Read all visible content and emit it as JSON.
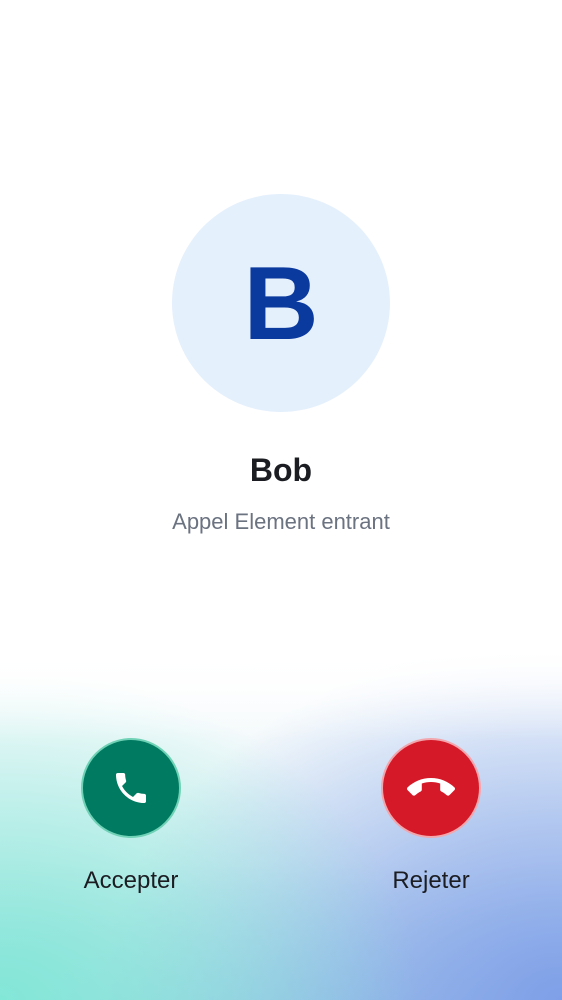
{
  "caller": {
    "avatar_initial": "B",
    "name": "Bob",
    "status": "Appel Element entrant"
  },
  "actions": {
    "accept": {
      "label": "Accepter",
      "icon": "phone-icon",
      "color": "#007a61"
    },
    "reject": {
      "label": "Rejeter",
      "icon": "phone-hangup-icon",
      "color": "#d51928"
    }
  },
  "colors": {
    "avatar_background": "#e5f0fd",
    "avatar_letter": "#0b3a9e",
    "gradient_left": "#80e8d6",
    "gradient_right": "#7c9ce8"
  }
}
